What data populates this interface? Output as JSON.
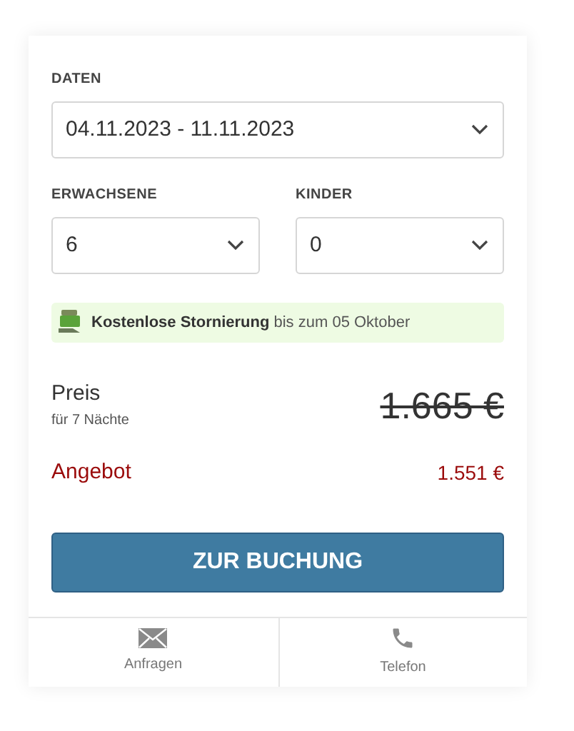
{
  "dates": {
    "label": "DATEN",
    "value": "04.11.2023 - 11.11.2023"
  },
  "guests": [
    {
      "label": "ERWACHSENE",
      "value": "6"
    },
    {
      "label": "KINDER",
      "value": "0"
    }
  ],
  "cancellation": {
    "title": "Kostenlose Stornierung",
    "detail": "bis zum 05 Oktober"
  },
  "price": {
    "label": "Preis",
    "note": "für 7 Nächte",
    "old_price": "1.665 €"
  },
  "offer": {
    "label": "Angebot",
    "price": "1.551 €"
  },
  "book_button": "ZUR BUCHUNG",
  "actions": [
    {
      "kind": "mail",
      "label": "Anfragen"
    },
    {
      "kind": "phone",
      "label": "Telefon"
    }
  ]
}
